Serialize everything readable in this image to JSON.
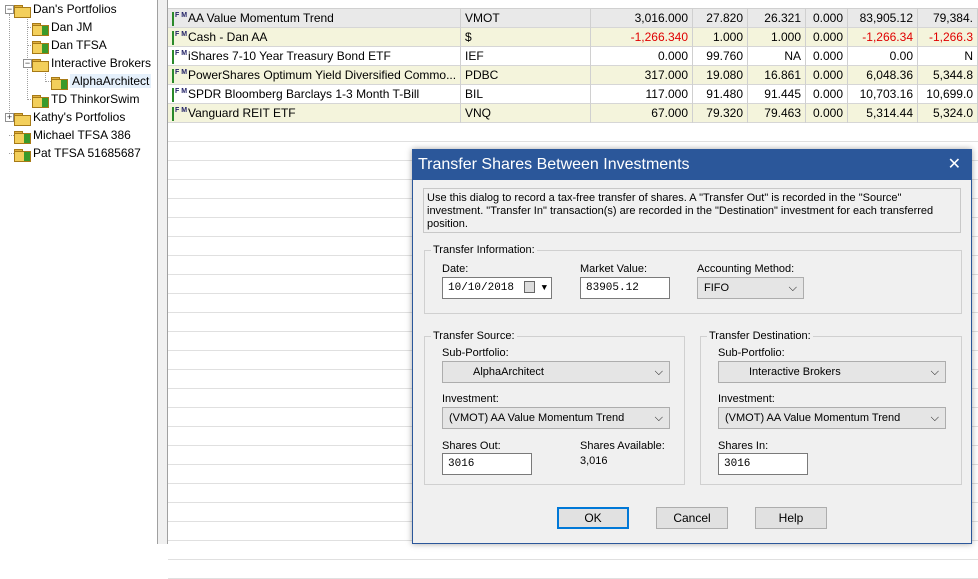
{
  "tree": {
    "items": [
      {
        "label": "Dan's Portfolios"
      },
      {
        "label": "Dan JM"
      },
      {
        "label": "Dan TFSA"
      },
      {
        "label": "Interactive Brokers"
      },
      {
        "label": "AlphaArchitect"
      },
      {
        "label": "TD ThinkorSwim"
      },
      {
        "label": "Kathy's Portfolios"
      },
      {
        "label": "Michael TFSA 386"
      },
      {
        "label": "Pat TFSA 51685687"
      }
    ]
  },
  "grid": {
    "rows": [
      {
        "name": "AA Value Momentum Trend",
        "symbol": "VMOT",
        "shares": "3,016.000",
        "price": "27.820",
        "cost": "26.321",
        "change": "0.000",
        "value": "83,905.12",
        "value2": "79,384.",
        "neg": false
      },
      {
        "name": "Cash - Dan AA",
        "symbol": "$",
        "shares": "-1,266.340",
        "price": "1.000",
        "cost": "1.000",
        "change": "0.000",
        "value": "-1,266.34",
        "value2": "-1,266.3",
        "neg": true
      },
      {
        "name": "iShares 7-10 Year Treasury Bond ETF",
        "symbol": "IEF",
        "shares": "0.000",
        "price": "99.760",
        "cost": "NA",
        "change": "0.000",
        "value": "0.00",
        "value2": "N",
        "neg": false
      },
      {
        "name": "PowerShares Optimum Yield Diversified Commo...",
        "symbol": "PDBC",
        "shares": "317.000",
        "price": "19.080",
        "cost": "16.861",
        "change": "0.000",
        "value": "6,048.36",
        "value2": "5,344.8",
        "neg": false
      },
      {
        "name": "SPDR Bloomberg Barclays 1-3 Month T-Bill",
        "symbol": "BIL",
        "shares": "117.000",
        "price": "91.480",
        "cost": "91.445",
        "change": "0.000",
        "value": "10,703.16",
        "value2": "10,699.0",
        "neg": false
      },
      {
        "name": "Vanguard REIT ETF",
        "symbol": "VNQ",
        "shares": "67.000",
        "price": "79.320",
        "cost": "79.463",
        "change": "0.000",
        "value": "5,314.44",
        "value2": "5,324.0",
        "neg": false
      }
    ]
  },
  "dialog": {
    "title": "Transfer Shares Between Investments",
    "close": "✕",
    "description": "Use this dialog to record a tax-free transfer of shares.  A \"Transfer Out\" is recorded in the \"Source\" investment.  \"Transfer In\" transaction(s) are recorded in the \"Destination\" investment for each transferred position.",
    "info": {
      "legend": "Transfer Information:",
      "date_label": "Date:",
      "date_value": "10/10/2018",
      "market_value_label": "Market Value:",
      "market_value": "83905.12",
      "method_label": "Accounting Method:",
      "method_value": "FIFO"
    },
    "source": {
      "legend": "Transfer Source:",
      "subportfolio_label": "Sub-Portfolio:",
      "subportfolio_value": "AlphaArchitect",
      "investment_label": "Investment:",
      "investment_value": "(VMOT) AA Value Momentum Trend",
      "shares_out_label": "Shares Out:",
      "shares_out_value": "3016",
      "shares_available_label": "Shares Available:",
      "shares_available_value": "3,016"
    },
    "destination": {
      "legend": "Transfer Destination:",
      "subportfolio_label": "Sub-Portfolio:",
      "subportfolio_value": "Interactive Brokers",
      "investment_label": "Investment:",
      "investment_value": "(VMOT) AA Value Momentum Trend",
      "shares_in_label": "Shares In:",
      "shares_in_value": "3016"
    },
    "buttons": {
      "ok": "OK",
      "cancel": "Cancel",
      "help": "Help"
    }
  }
}
